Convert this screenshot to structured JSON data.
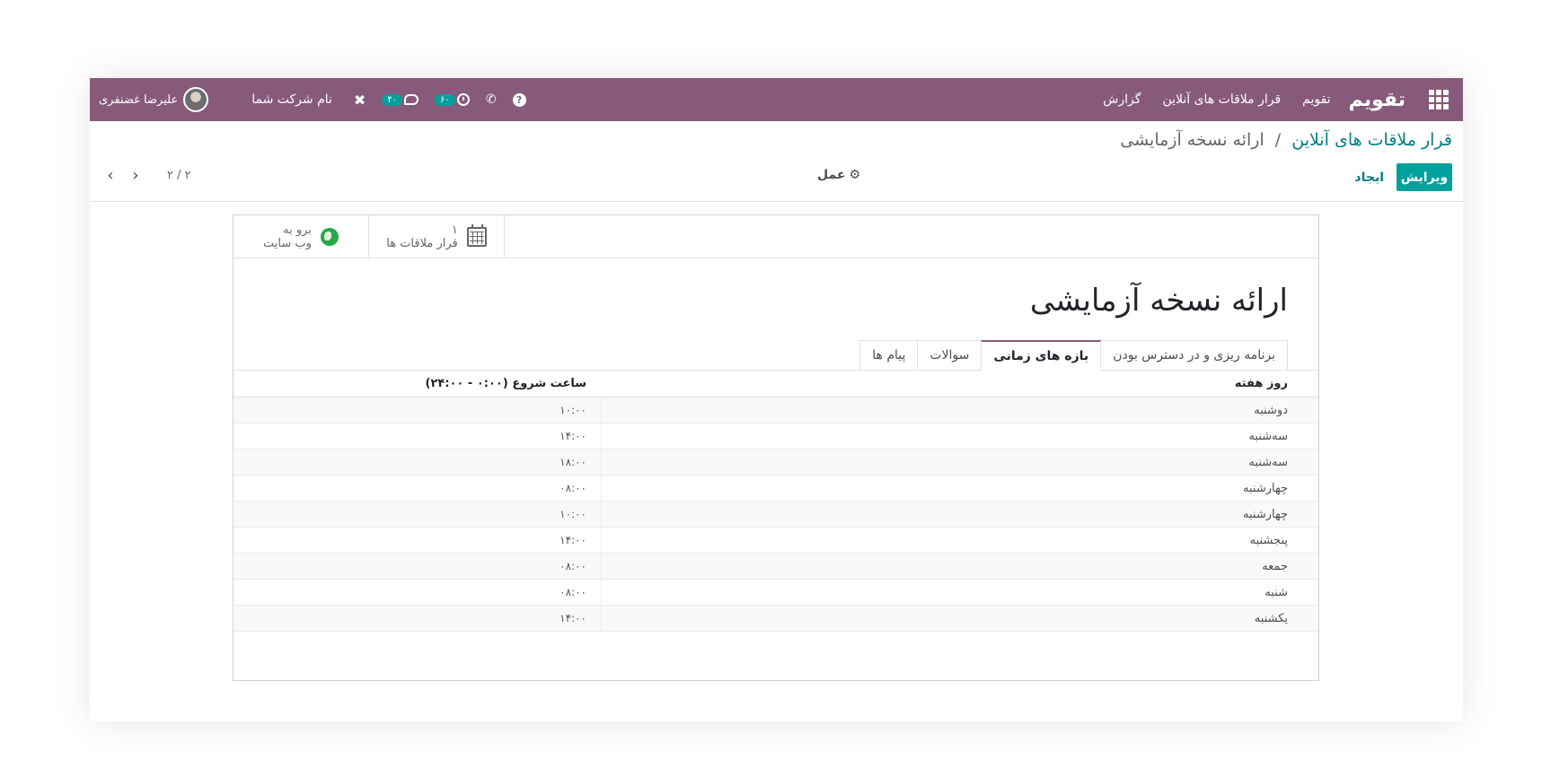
{
  "navbar": {
    "brand": "تقویم",
    "menu": [
      "تقویم",
      "قرار ملاقات های آنلاین",
      "گزارش"
    ],
    "messages_badge": "۴۰",
    "activities_badge": "۶۰",
    "help_label": "?",
    "company": "نام شرکت شما",
    "user": "علیرضا غضنفری",
    "color": "#875a7b"
  },
  "breadcrumb": {
    "parent": "قرار ملاقات های آنلاین",
    "separator": "/",
    "current": "ارائه نسخه آزمایشی"
  },
  "buttons": {
    "edit": "ویرایش",
    "create": "ایجاد",
    "action": "عمل"
  },
  "pager": {
    "value": "۲ / ۲"
  },
  "stat_buttons": {
    "website_line1": "برو به",
    "website_line2": "وب سایت",
    "meetings_count": "۱",
    "meetings_label": "قرار ملاقات ها"
  },
  "form": {
    "title": "ارائه نسخه آزمایشی",
    "tabs": [
      "برنامه ریزی و در دسترس بودن",
      "بازه های زمانی",
      "سوالات",
      "پیام ها"
    ],
    "active_tab": "بازه های زمانی"
  },
  "table": {
    "headers": [
      "روز هفته",
      "ساعت شروع (۰:۰۰ - ۲۴:۰۰)"
    ],
    "rows": [
      {
        "day": "دوشنبه",
        "time": "۱۰:۰۰"
      },
      {
        "day": "سه‌شنبه",
        "time": "۱۴:۰۰"
      },
      {
        "day": "سه‌شنبه",
        "time": "۱۸:۰۰"
      },
      {
        "day": "چهارشنبه",
        "time": "۰۸:۰۰"
      },
      {
        "day": "چهارشنبه",
        "time": "۱۰:۰۰"
      },
      {
        "day": "پنجشنبه",
        "time": "۱۴:۰۰"
      },
      {
        "day": "جمعه",
        "time": "۰۸:۰۰"
      },
      {
        "day": "شنبه",
        "time": "۰۸:۰۰"
      },
      {
        "day": "یکشنبه",
        "time": "۱۴:۰۰"
      }
    ]
  }
}
